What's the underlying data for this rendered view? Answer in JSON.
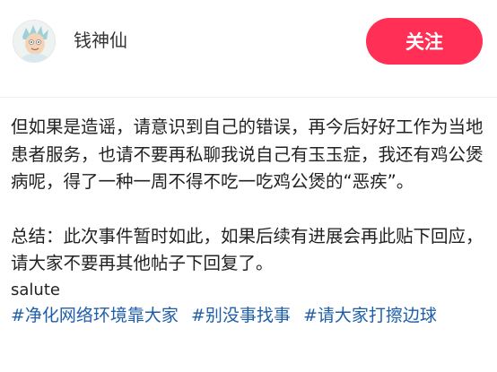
{
  "header": {
    "username": "钱神仙",
    "follow_label": "关注"
  },
  "post": {
    "paragraph_1": "但如果是造谣，请意识到自己的错误，再今后好好工作为当地患者服务，也请不要再私聊我说自己有玉玉症，我还有鸡公煲病呢，得了一种一周不得不吃一吃鸡公煲的“恶疾”。",
    "paragraph_2": "总结：此次事件暂时如此，如果后续有进展会再此贴下回应，请大家不要再其他帖子下回复了。",
    "salute": "salute",
    "hashtags": [
      "#净化网络环境靠大家",
      "#别没事找事",
      "#请大家打擦边球"
    ]
  },
  "icons": {
    "avatar": "cartoon-character-avatar"
  },
  "colors": {
    "accent": "#ff2f55",
    "hashtag": "#1f5ea8"
  }
}
